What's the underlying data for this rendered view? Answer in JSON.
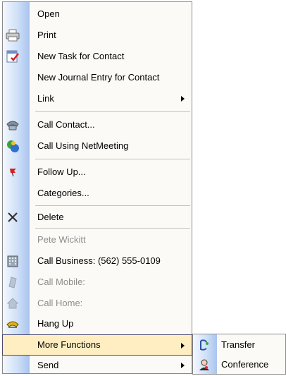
{
  "menu": {
    "items": [
      {
        "label": "Open",
        "icon": "none"
      },
      {
        "label": "Print",
        "icon": "printer-icon"
      },
      {
        "label": "New Task for Contact",
        "icon": "task-icon"
      },
      {
        "label": "New Journal Entry for Contact",
        "icon": "none"
      },
      {
        "label": "Link",
        "icon": "none",
        "submenu": true
      },
      {
        "label": "Call Contact...",
        "icon": "phone-icon"
      },
      {
        "label": "Call Using NetMeeting",
        "icon": "netmeeting-icon"
      },
      {
        "label": "Follow Up...",
        "icon": "flag-icon"
      },
      {
        "label": "Categories...",
        "icon": "none"
      },
      {
        "label": "Delete",
        "icon": "delete-icon"
      },
      {
        "label": "Pete Wickitt",
        "icon": "none",
        "disabled": true
      },
      {
        "label": "Call Business: (562) 555-0109",
        "icon": "building-icon"
      },
      {
        "label": "Call Mobile:",
        "icon": "mobile-icon",
        "disabled": true
      },
      {
        "label": "Call Home:",
        "icon": "home-icon",
        "disabled": true
      },
      {
        "label": "Hang Up",
        "icon": "hang-up-icon"
      },
      {
        "label": "More Functions",
        "icon": "none",
        "submenu": true,
        "highlighted": true
      },
      {
        "label": "Send",
        "icon": "none",
        "submenu": true
      }
    ]
  },
  "submenu": {
    "items": [
      {
        "label": "Transfer",
        "icon": "transfer-icon"
      },
      {
        "label": "Conference",
        "icon": "conference-icon"
      }
    ]
  },
  "colors": {
    "highlight": "#ffeec2",
    "gutter": "#a9c4ee",
    "disabled_text": "#8d8d8d"
  }
}
